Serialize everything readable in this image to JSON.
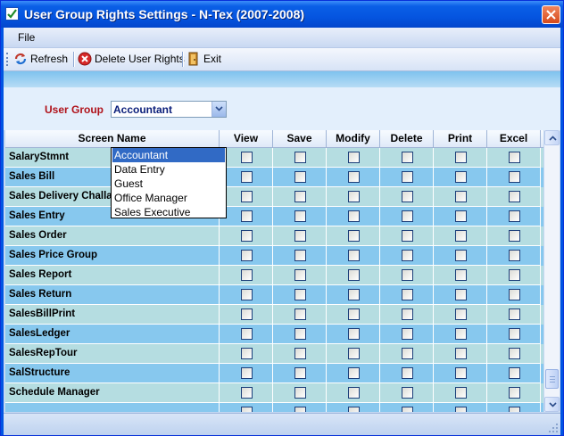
{
  "window": {
    "title": "User Group Rights Settings - N-Tex (2007-2008)"
  },
  "menu": {
    "file": "File"
  },
  "toolbar": {
    "refresh": "Refresh",
    "delete": "Delete User Rights",
    "exit": "Exit"
  },
  "form": {
    "user_group_label": "User Group",
    "selected_group": "Accountant"
  },
  "dropdown": {
    "options": [
      "Accountant",
      "Data Entry",
      "Guest",
      "Office Manager",
      "Sales Executive"
    ],
    "selected_index": 0
  },
  "grid": {
    "columns": [
      "Screen Name",
      "View",
      "Save",
      "Modify",
      "Delete",
      "Print",
      "Excel"
    ],
    "rows": [
      "SalaryStmnt",
      "Sales Bill",
      "Sales Delivery Challan",
      "Sales Entry",
      "Sales Order",
      "Sales Price Group",
      "Sales Report",
      "Sales Return",
      "SalesBillPrint",
      "SalesLedger",
      "SalesRepTour",
      "SalStructure",
      "Schedule Manager",
      ""
    ]
  },
  "colors": {
    "title_bar": "#0555e0",
    "row_even": "#b5dde1",
    "row_odd": "#87c8ee",
    "label_red": "#b0121a",
    "selection": "#316ac5"
  },
  "icons": {
    "app": "check-icon",
    "close": "close-icon",
    "refresh": "refresh-icon",
    "delete": "delete-icon",
    "exit": "exit-icon",
    "dropdown": "chevron-down-icon"
  }
}
